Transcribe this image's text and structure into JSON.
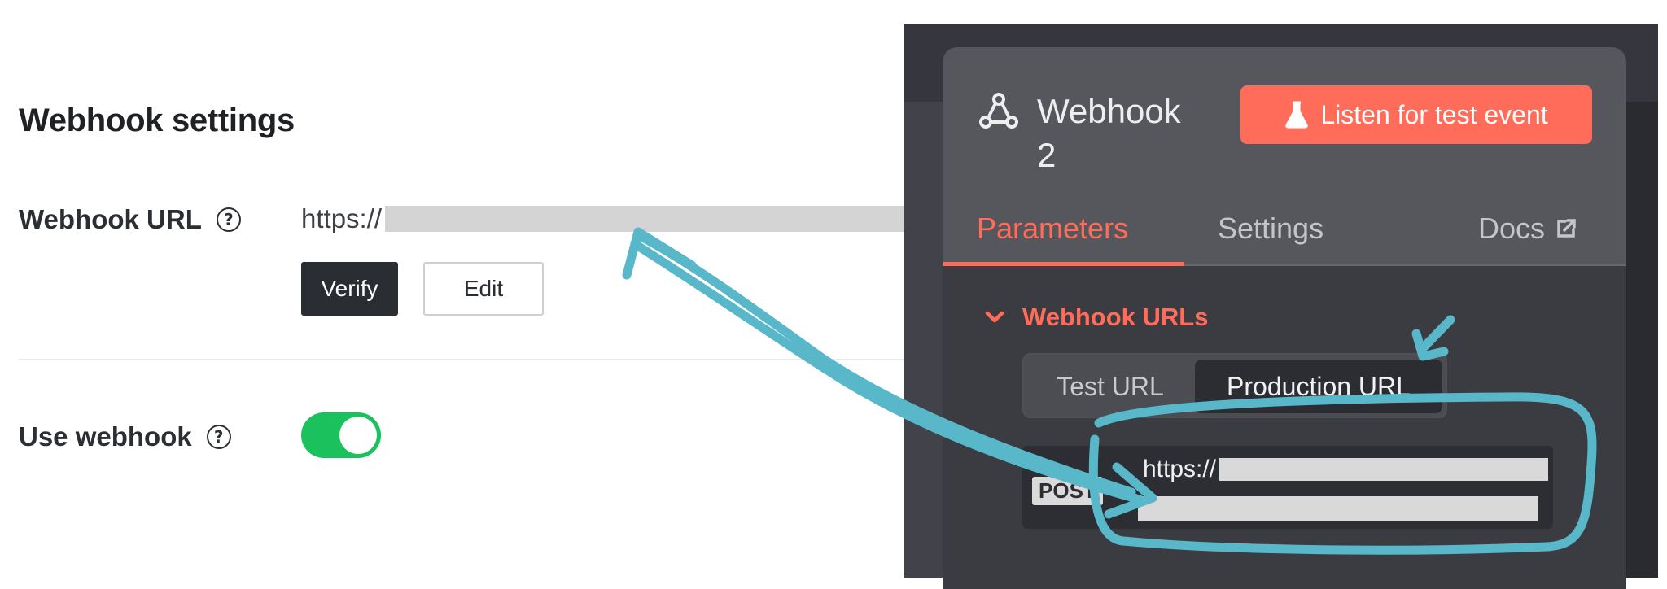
{
  "settings": {
    "title": "Webhook settings",
    "webhook_url_label": "Webhook URL",
    "webhook_url_value": "https://",
    "verify_label": "Verify",
    "edit_label": "Edit",
    "use_webhook_label": "Use webhook",
    "use_webhook_enabled": true,
    "help_glyph": "?"
  },
  "panel": {
    "title": "Webhook 2",
    "listen_button": "Listen for test event",
    "tabs": [
      {
        "label": "Parameters",
        "active": true
      },
      {
        "label": "Settings",
        "active": false
      },
      {
        "label": "Docs",
        "active": false
      }
    ],
    "section_title": "Webhook URLs",
    "url_tabs": [
      {
        "label": "Test URL",
        "selected": false
      },
      {
        "label": "Production URL",
        "selected": true
      }
    ],
    "method": "POST",
    "url_value": "https://"
  },
  "colors": {
    "accent": "#ff6d5a",
    "toggle_on": "#1bc15c",
    "annotation": "#58b7c8",
    "dark_panel": "#56575d"
  },
  "icons": [
    "help-icon",
    "webhook-icon",
    "flask-icon",
    "chevron-down-icon",
    "external-link-icon"
  ]
}
